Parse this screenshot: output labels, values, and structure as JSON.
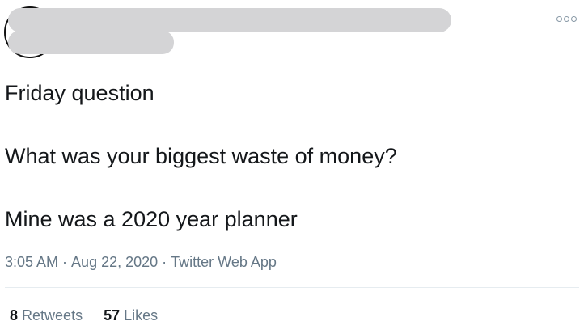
{
  "tweet": {
    "lines": [
      "Friday question",
      "What was your biggest waste of money?",
      "Mine was a 2020 year planner"
    ],
    "time": "3:05 AM",
    "date": "Aug 22, 2020",
    "source": "Twitter Web App",
    "separator": "·"
  },
  "stats": {
    "retweets_count": "8",
    "retweets_label": "Retweets",
    "likes_count": "57",
    "likes_label": "Likes"
  },
  "colors": {
    "text": "#14171a",
    "secondary": "#657786",
    "redaction": "#d4d4d6",
    "divider": "#e6ecf0"
  },
  "icons": {
    "more": "more-options-icon"
  }
}
